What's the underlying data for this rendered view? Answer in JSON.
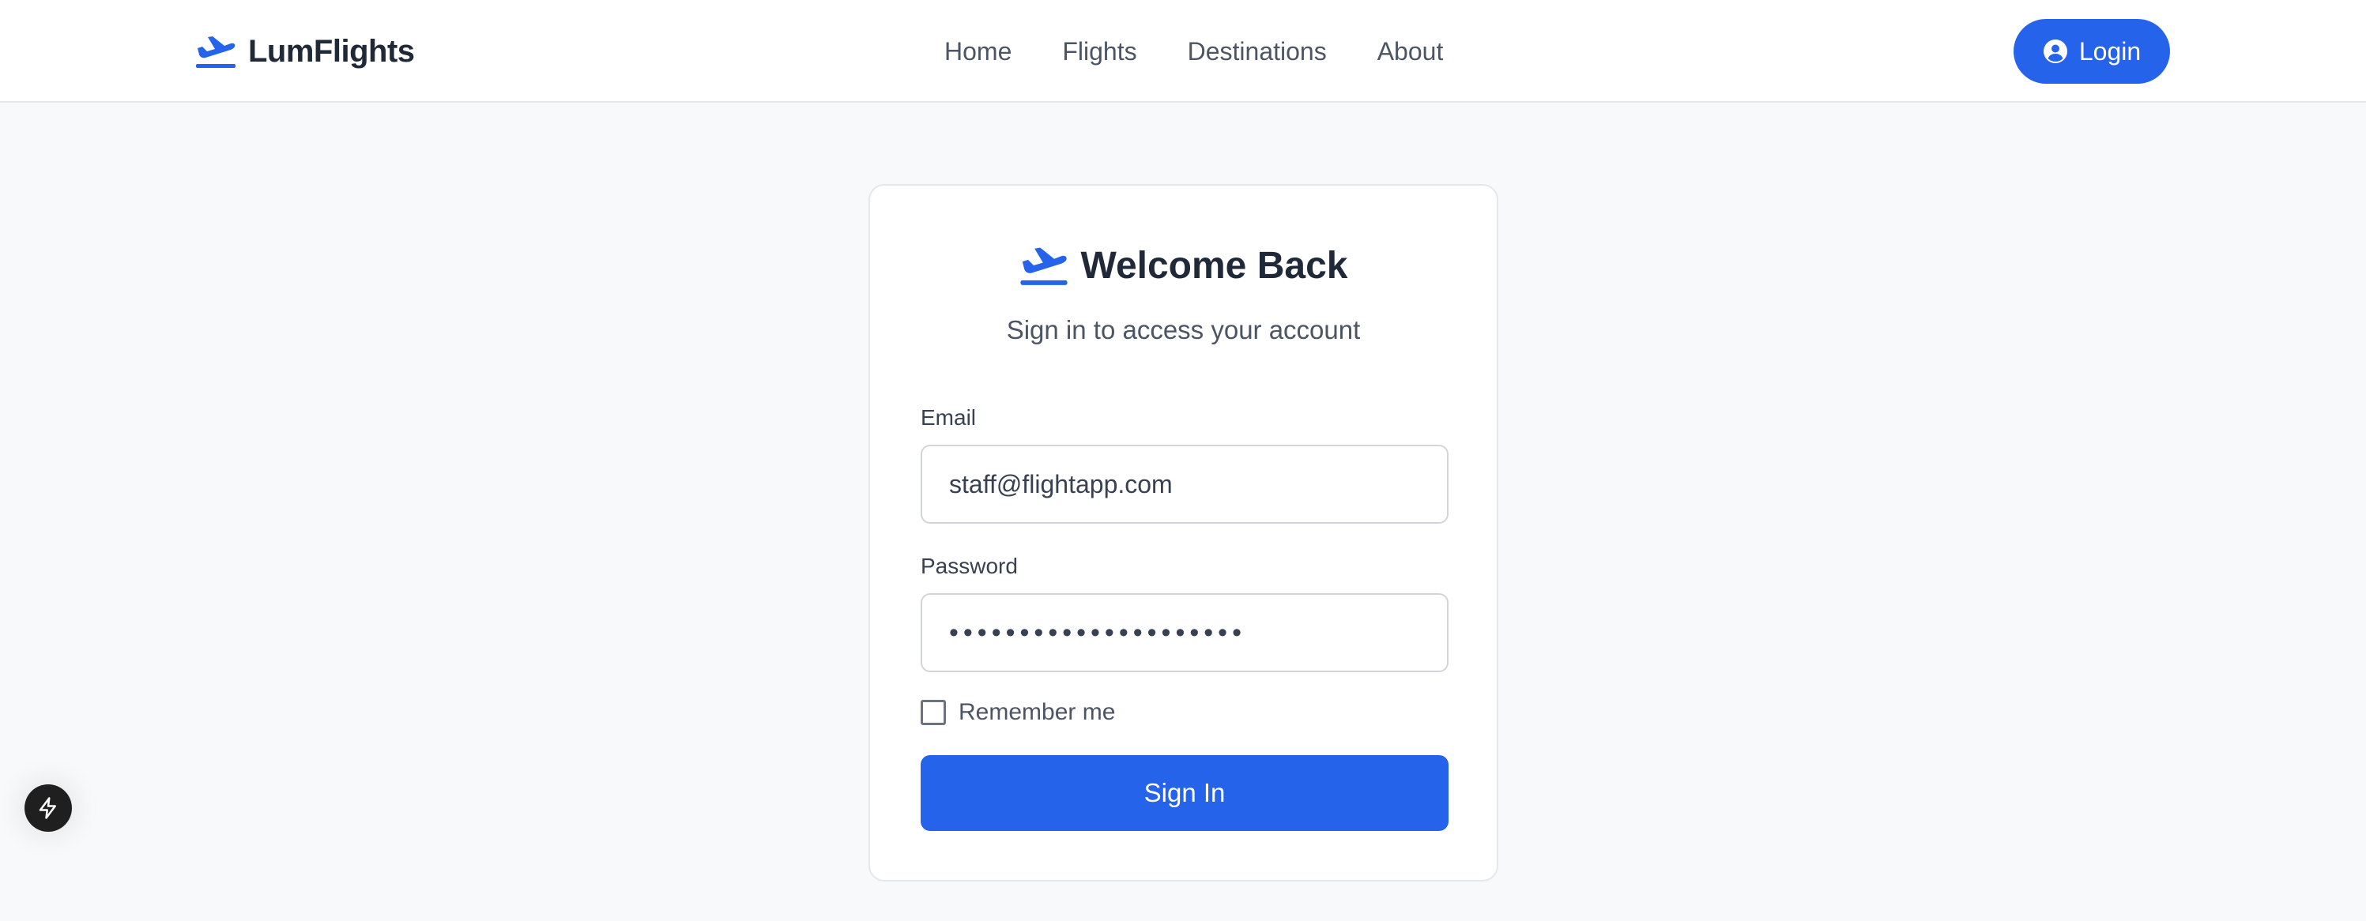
{
  "colors": {
    "accent": "#2563eb",
    "background": "#f8f9fb",
    "text": "#1f2937",
    "muted": "#4b5563"
  },
  "header": {
    "brand_icon": "plane-departure-icon",
    "brand_name": "LumFlights",
    "nav": [
      "Home",
      "Flights",
      "Destinations",
      "About"
    ],
    "login_icon": "user-circle-icon",
    "login_label": "Login"
  },
  "login_card": {
    "title_icon": "plane-departure-icon",
    "title": "Welcome Back",
    "subtitle": "Sign in to access your account",
    "email": {
      "label": "Email",
      "value": "staff@flightapp.com"
    },
    "password": {
      "label": "Password",
      "value": "•••••••••••••••••••••"
    },
    "remember_me": {
      "label": "Remember me",
      "checked": false
    },
    "submit_label": "Sign In"
  },
  "floating_button": {
    "icon": "lightning-bolt-icon"
  }
}
